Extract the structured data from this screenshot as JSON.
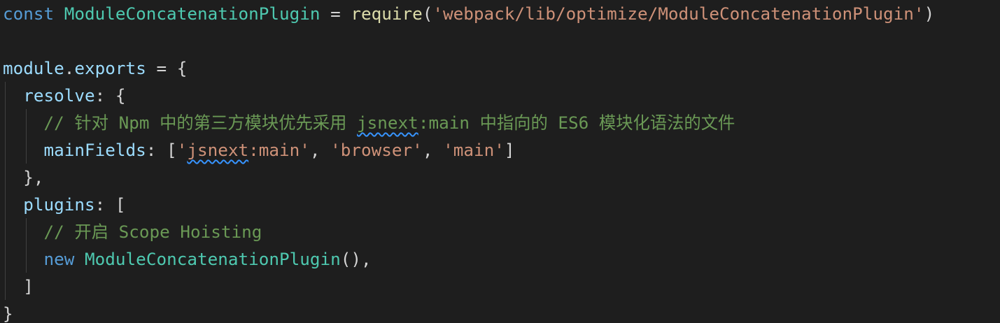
{
  "editor": {
    "lines": [
      {
        "tokens": [
          {
            "text": "const",
            "kind": "keyword"
          },
          {
            "text": " ",
            "kind": "space"
          },
          {
            "text": "ModuleConcatenationPlugin",
            "kind": "class"
          },
          {
            "text": " = ",
            "kind": "punct"
          },
          {
            "text": "require",
            "kind": "function"
          },
          {
            "text": "(",
            "kind": "punct"
          },
          {
            "text": "'webpack/lib/optimize/ModuleConcatenationPlugin'",
            "kind": "string"
          },
          {
            "text": ")",
            "kind": "punct"
          }
        ]
      },
      {
        "tokens": []
      },
      {
        "tokens": [
          {
            "text": "module",
            "kind": "variable"
          },
          {
            "text": ".",
            "kind": "punct"
          },
          {
            "text": "exports",
            "kind": "variable"
          },
          {
            "text": " = {",
            "kind": "punct"
          }
        ]
      },
      {
        "tokens": [
          {
            "text": "  ",
            "kind": "space"
          },
          {
            "text": "resolve",
            "kind": "variable"
          },
          {
            "text": ": {",
            "kind": "punct"
          }
        ]
      },
      {
        "tokens": [
          {
            "text": "    ",
            "kind": "space"
          },
          {
            "text": "// 针对 Npm 中的第三方模块优先采用 ",
            "kind": "comment"
          },
          {
            "text": "jsnext",
            "kind": "comment",
            "squiggle": true
          },
          {
            "text": ":main 中指向的 ES6 模块化语法的文件",
            "kind": "comment"
          }
        ]
      },
      {
        "tokens": [
          {
            "text": "    ",
            "kind": "space"
          },
          {
            "text": "mainFields",
            "kind": "variable"
          },
          {
            "text": ": [",
            "kind": "punct"
          },
          {
            "text": "'",
            "kind": "string"
          },
          {
            "text": "jsnext",
            "kind": "string",
            "squiggle": true
          },
          {
            "text": ":main'",
            "kind": "string"
          },
          {
            "text": ", ",
            "kind": "punct"
          },
          {
            "text": "'browser'",
            "kind": "string"
          },
          {
            "text": ", ",
            "kind": "punct"
          },
          {
            "text": "'main'",
            "kind": "string"
          },
          {
            "text": "]",
            "kind": "punct"
          }
        ]
      },
      {
        "tokens": [
          {
            "text": "  },",
            "kind": "punct"
          }
        ]
      },
      {
        "tokens": [
          {
            "text": "  ",
            "kind": "space"
          },
          {
            "text": "plugins",
            "kind": "variable"
          },
          {
            "text": ": [",
            "kind": "punct"
          }
        ]
      },
      {
        "tokens": [
          {
            "text": "    ",
            "kind": "space"
          },
          {
            "text": "// 开启 Scope Hoisting",
            "kind": "comment"
          }
        ]
      },
      {
        "tokens": [
          {
            "text": "    ",
            "kind": "space"
          },
          {
            "text": "new",
            "kind": "keyword"
          },
          {
            "text": " ",
            "kind": "space"
          },
          {
            "text": "ModuleConcatenationPlugin",
            "kind": "class"
          },
          {
            "text": "(),",
            "kind": "punct"
          }
        ]
      },
      {
        "tokens": [
          {
            "text": "  ]",
            "kind": "punct"
          }
        ]
      },
      {
        "tokens": [
          {
            "text": "}",
            "kind": "punct"
          }
        ]
      }
    ]
  },
  "theme": {
    "background": "#1e1e1e",
    "keyword": "#569cd6",
    "class": "#4ec9b0",
    "function": "#dcdcaa",
    "string": "#ce9178",
    "variable": "#9cdcfe",
    "comment": "#6a9955",
    "punct": "#d4d4d4",
    "squiggle": "#3794ff",
    "indent_guide": "#404040"
  }
}
